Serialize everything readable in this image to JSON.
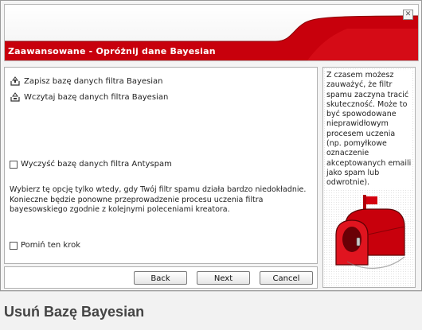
{
  "header": {
    "title": "Zaawansowane - Opróżnij dane Bayesian",
    "close_glyph": "✕",
    "accent_color": "#c8000c"
  },
  "options": {
    "save_label": "Zapisz bazę danych filtra Bayesian",
    "load_label": "Wczytaj bazę danych filtra Bayesian",
    "clear_label": "Wyczyść bazę danych filtra Antyspam",
    "skip_label": "Pomiń ten krok",
    "save_icon": "upload-icon",
    "load_icon": "download-icon"
  },
  "description": "Wybierz tę opcję tylko wtedy, gdy Twój filtr spamu działa bardzo niedokładnie. Konieczne będzie ponowne przeprowadzenie procesu uczenia filtra bayesowskiego zgodnie z kolejnymi poleceniami kreatora.",
  "tip": "Z czasem możesz zauważyć, że filtr spamu zaczyna tracić skuteczność. Może to być spowodowane nieprawidłowym procesem uczenia (np. pomyłkowe oznaczenie akceptowanych emaili jako spam lub odwrotnie).",
  "buttons": {
    "back": "Back",
    "next": "Next",
    "cancel": "Cancel"
  },
  "caption": "Usuń Bazę Bayesian"
}
